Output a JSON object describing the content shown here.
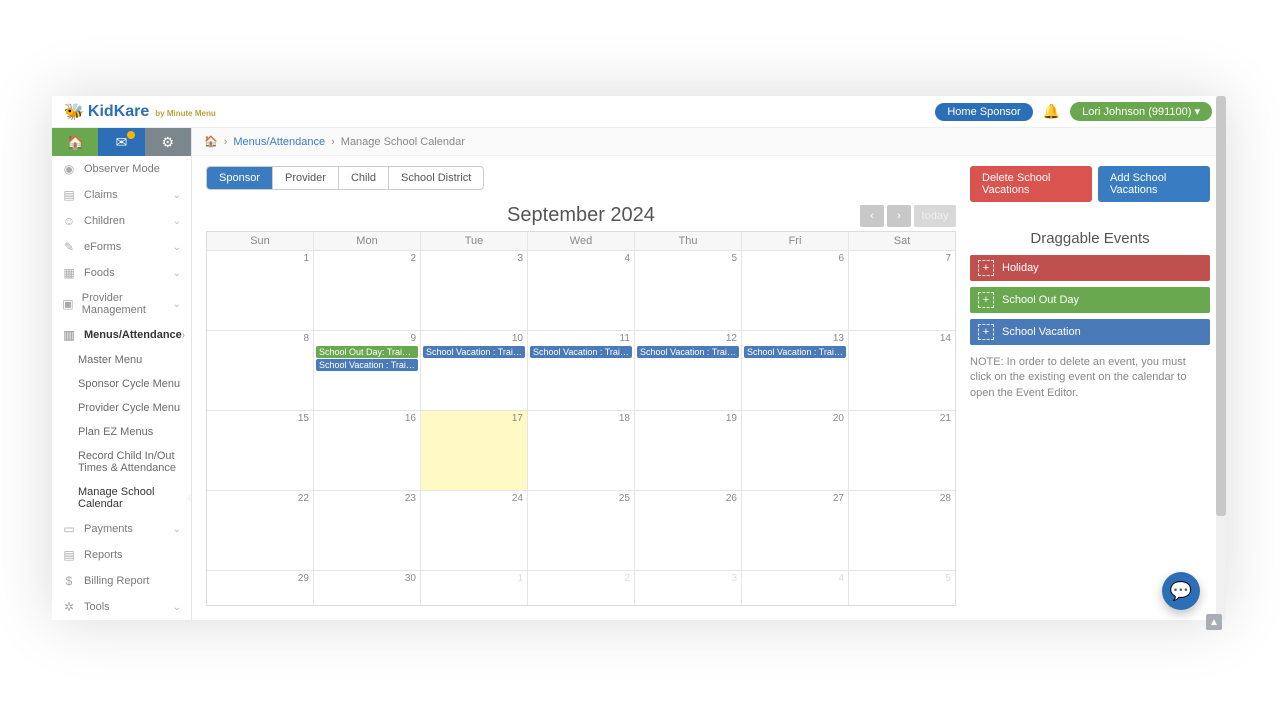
{
  "brand": {
    "name": "KidKare",
    "tagline": "by Minute Menu"
  },
  "header": {
    "home_sponsor": "Home Sponsor",
    "user_pill": "Lori Johnson (991100) ▾"
  },
  "breadcrumb": {
    "link": "Menus/Attendance",
    "current": "Manage School Calendar"
  },
  "filter_tabs": [
    "Sponsor",
    "Provider",
    "Child",
    "School District"
  ],
  "filter_selected": "Sponsor",
  "actions": {
    "delete": "Delete School Vacations",
    "add": "Add School Vacations"
  },
  "calendar": {
    "title": "September 2024",
    "today_label": "today",
    "dow": [
      "Sun",
      "Mon",
      "Tue",
      "Wed",
      "Thu",
      "Fri",
      "Sat"
    ],
    "weeks": [
      {
        "days": [
          {
            "n": "1"
          },
          {
            "n": "2"
          },
          {
            "n": "3"
          },
          {
            "n": "4"
          },
          {
            "n": "5"
          },
          {
            "n": "6"
          },
          {
            "n": "7"
          }
        ]
      },
      {
        "days": [
          {
            "n": "8"
          },
          {
            "n": "9",
            "events": [
              {
                "cls": "ev-green",
                "label": "School Out Day: Training…"
              },
              {
                "cls": "ev-blue",
                "label": "School Vacation : Trainin…"
              }
            ]
          },
          {
            "n": "10",
            "events": [
              {
                "cls": "ev-blue",
                "label": "School Vacation : Trainin…"
              }
            ]
          },
          {
            "n": "11",
            "events": [
              {
                "cls": "ev-blue",
                "label": "School Vacation : Trainin…"
              }
            ]
          },
          {
            "n": "12",
            "events": [
              {
                "cls": "ev-blue",
                "label": "School Vacation : Trainin…"
              }
            ]
          },
          {
            "n": "13",
            "events": [
              {
                "cls": "ev-blue",
                "label": "School Vacation : Trainin…"
              }
            ]
          },
          {
            "n": "14"
          }
        ]
      },
      {
        "days": [
          {
            "n": "15"
          },
          {
            "n": "16"
          },
          {
            "n": "17",
            "hl": true
          },
          {
            "n": "18"
          },
          {
            "n": "19"
          },
          {
            "n": "20"
          },
          {
            "n": "21"
          }
        ]
      },
      {
        "days": [
          {
            "n": "22"
          },
          {
            "n": "23"
          },
          {
            "n": "24"
          },
          {
            "n": "25"
          },
          {
            "n": "26"
          },
          {
            "n": "27"
          },
          {
            "n": "28"
          }
        ]
      },
      {
        "short": true,
        "days": [
          {
            "n": "29"
          },
          {
            "n": "30"
          },
          {
            "n": "1",
            "dim": true
          },
          {
            "n": "2",
            "dim": true
          },
          {
            "n": "3",
            "dim": true
          },
          {
            "n": "4",
            "dim": true
          },
          {
            "n": "5",
            "dim": true
          }
        ]
      }
    ]
  },
  "sidebar": {
    "items": [
      {
        "icon": "◉",
        "label": "Observer Mode"
      },
      {
        "icon": "▤",
        "label": "Claims",
        "chev": true
      },
      {
        "icon": "☺",
        "label": "Children",
        "chev": true
      },
      {
        "icon": "✎",
        "label": "eForms",
        "chev": true
      },
      {
        "icon": "▦",
        "label": "Foods",
        "chev": true
      },
      {
        "icon": "▣",
        "label": "Provider Management",
        "chev": true
      },
      {
        "icon": "▥",
        "label": "Menus/Attendance",
        "chev": true,
        "active": true,
        "subs": [
          "Master Menu",
          "Sponsor Cycle Menu",
          "Provider Cycle Menu",
          "Plan EZ Menus",
          "Record Child In/Out Times & Attendance",
          "Manage School Calendar"
        ],
        "current_sub": "Manage School Calendar"
      },
      {
        "icon": "▭",
        "label": "Payments",
        "chev": true
      },
      {
        "icon": "▤",
        "label": "Reports"
      },
      {
        "icon": "$",
        "label": "Billing Report"
      },
      {
        "icon": "✲",
        "label": "Tools",
        "chev": true
      }
    ]
  },
  "draggable": {
    "title": "Draggable Events",
    "items": [
      {
        "cls": "di-red",
        "label": "Holiday"
      },
      {
        "cls": "di-green",
        "label": "School Out Day"
      },
      {
        "cls": "di-blue",
        "label": "School Vacation"
      }
    ],
    "note": "NOTE: In order to delete an event, you must click on the existing event on the calendar to open the Event Editor."
  }
}
